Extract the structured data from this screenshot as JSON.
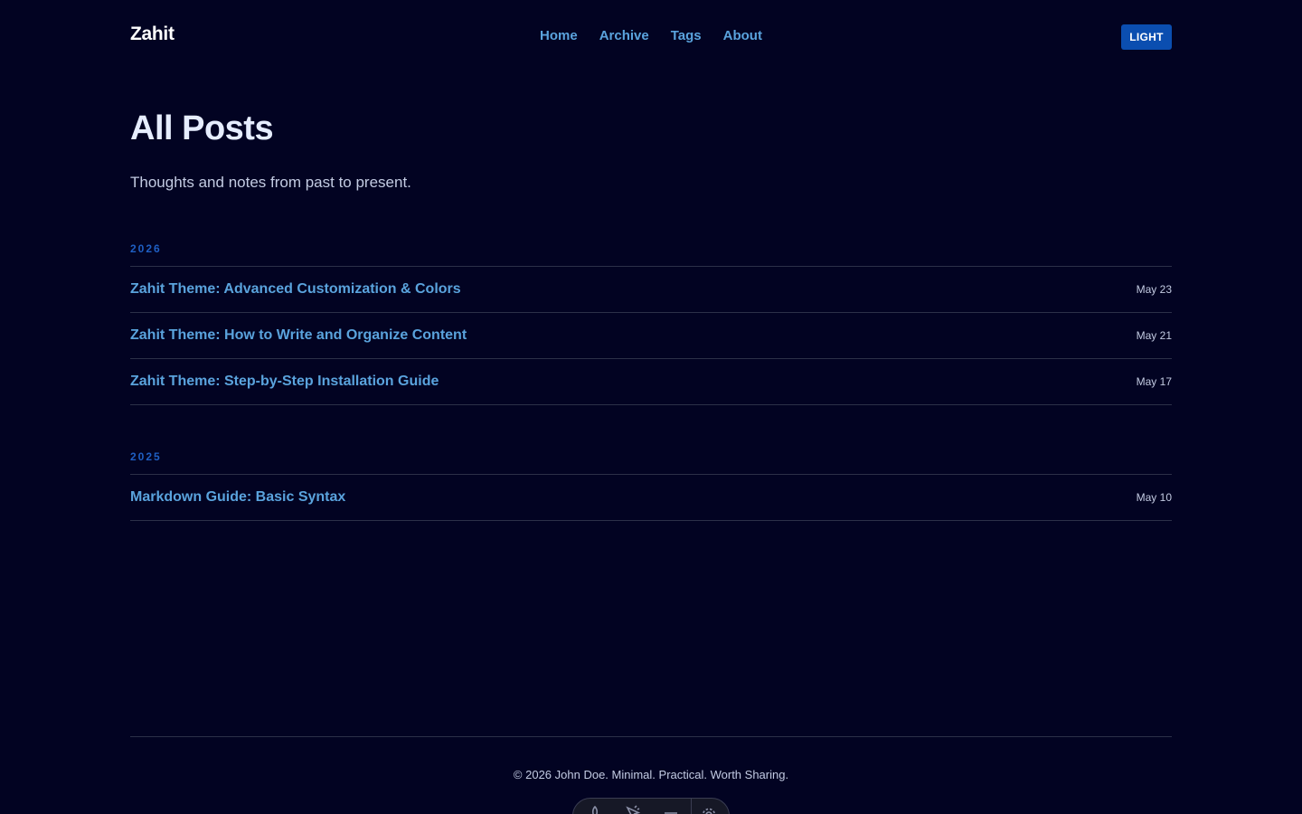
{
  "header": {
    "brand": "Zahit",
    "nav": [
      {
        "label": "Home"
      },
      {
        "label": "Archive"
      },
      {
        "label": "Tags"
      },
      {
        "label": "About"
      }
    ],
    "theme_toggle_label": "LIGHT"
  },
  "main": {
    "title": "All Posts",
    "subtitle": "Thoughts and notes from past to present.",
    "years": [
      {
        "year": "2026",
        "posts": [
          {
            "title": "Zahit Theme: Advanced Customization & Colors",
            "date": "May 23"
          },
          {
            "title": "Zahit Theme: How to Write and Organize Content",
            "date": "May 21"
          },
          {
            "title": "Zahit Theme: Step-by-Step Installation Guide",
            "date": "May 17"
          }
        ]
      },
      {
        "year": "2025",
        "posts": [
          {
            "title": "Markdown Guide: Basic Syntax",
            "date": "May 10"
          }
        ]
      }
    ]
  },
  "footer": {
    "text": "© 2026 John Doe. Minimal. Practical. Worth Sharing."
  },
  "dev_toolbar": {
    "icons": [
      "rocket-icon",
      "pointer-icon",
      "menu-icon",
      "gear-icon"
    ]
  },
  "colors": {
    "background": "#020322",
    "link": "#5aa3dd",
    "accent": "#0b4eb0",
    "year_label": "#1f5fc4",
    "heading": "#e6edff",
    "muted_text": "#c3cbe2",
    "divider": "#2c3048"
  }
}
